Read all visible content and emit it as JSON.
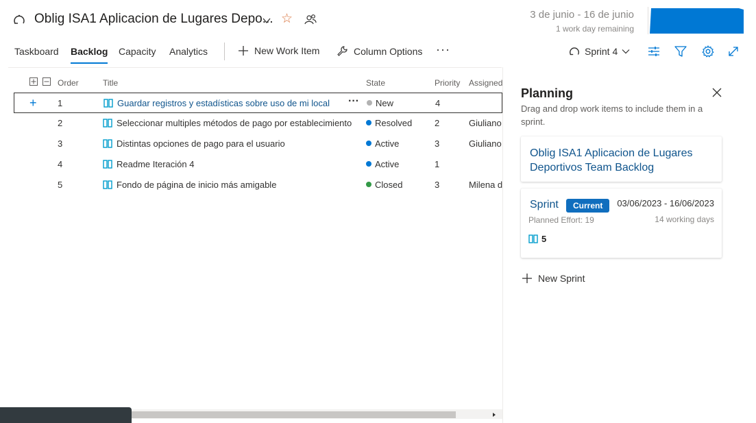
{
  "header": {
    "title": "Oblig ISA1 Aplicacion de Lugares Depo...",
    "date_range": "3 de junio - 16 de junio",
    "remaining": "1 work day remaining"
  },
  "nav": {
    "tabs": [
      {
        "label": "Taskboard"
      },
      {
        "label": "Backlog",
        "active": true
      },
      {
        "label": "Capacity"
      },
      {
        "label": "Analytics"
      }
    ],
    "new_work_item": "New Work Item",
    "column_options": "Column Options",
    "more": "···",
    "sprint_selector": "Sprint 4"
  },
  "grid": {
    "columns": {
      "order": "Order",
      "title": "Title",
      "state": "State",
      "priority": "Priority",
      "assigned": "Assigned"
    },
    "rows": [
      {
        "order": "1",
        "title": "Guardar registros y estadísticas sobre uso de mi local",
        "state": "New",
        "state_color": "#b2b2b2",
        "priority": "4",
        "assigned": ""
      },
      {
        "order": "2",
        "title": "Seleccionar multiples métodos de pago por establecimiento",
        "state": "Resolved",
        "state_color": "#0078d4",
        "priority": "2",
        "assigned": "Giuliano"
      },
      {
        "order": "3",
        "title": "Distintas opciones de pago para el usuario",
        "state": "Active",
        "state_color": "#0078d4",
        "priority": "3",
        "assigned": "Giuliano"
      },
      {
        "order": "4",
        "title": "Readme Iteración 4",
        "state": "Active",
        "state_color": "#0078d4",
        "priority": "1",
        "assigned": ""
      },
      {
        "order": "5",
        "title": "Fondo de página de inicio más amigable",
        "state": "Closed",
        "state_color": "#339947",
        "priority": "3",
        "assigned": "Milena d"
      }
    ]
  },
  "planning": {
    "title": "Planning",
    "description": "Drag and drop work items to include them in a sprint.",
    "backlog_card": "Oblig ISA1 Aplicacion de Lugares Deportivos Team Backlog",
    "sprint_card": {
      "name": "Sprint",
      "badge": "Current",
      "dates": "03/06/2023 - 16/06/2023",
      "effort": "Planned Effort: 19",
      "working_days": "14 working days",
      "count": "5"
    },
    "new_sprint": "New Sprint"
  },
  "colors": {
    "accent": "#0078d4",
    "link": "#0f548c",
    "star": "#d8703a",
    "backlog_icon": "#009ccc"
  }
}
